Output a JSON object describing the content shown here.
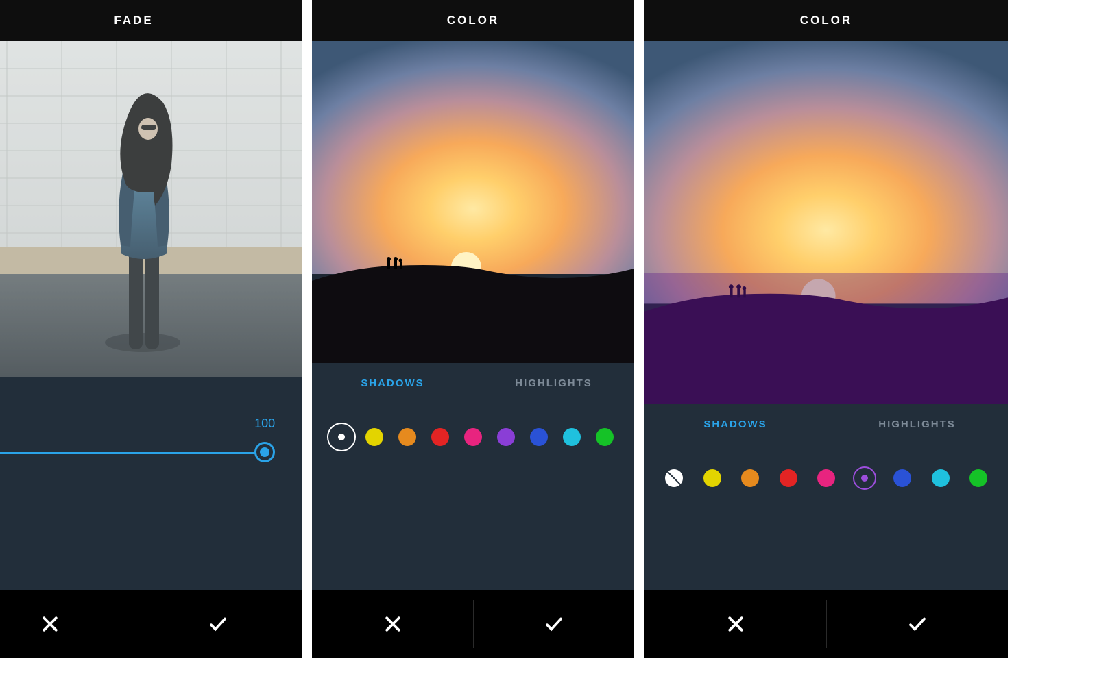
{
  "screens": [
    {
      "id": "fade",
      "title": "FADE",
      "slider": {
        "value_label": "100",
        "value": 100,
        "min": 0,
        "max": 100
      },
      "actions": {
        "cancel_icon": "close-icon",
        "confirm_icon": "check-icon"
      }
    },
    {
      "id": "color-none",
      "title": "COLOR",
      "tabs": {
        "shadows": "SHADOWS",
        "highlights": "HIGHLIGHTS",
        "active": "shadows"
      },
      "swatches": {
        "selected_index": 0,
        "colors": [
          "none",
          "#e3d400",
          "#e68a1e",
          "#e32424",
          "#e8247f",
          "#8a3ed6",
          "#2a52d6",
          "#1fc1de",
          "#15c227"
        ]
      },
      "actions": {
        "cancel_icon": "close-icon",
        "confirm_icon": "check-icon"
      }
    },
    {
      "id": "color-purple",
      "title": "COLOR",
      "tabs": {
        "shadows": "SHADOWS",
        "highlights": "HIGHLIGHTS",
        "active": "shadows"
      },
      "swatches": {
        "selected_index": 5,
        "colors": [
          "none",
          "#e3d400",
          "#e68a1e",
          "#e32424",
          "#e8247f",
          "#8a3ed6",
          "#2a52d6",
          "#1fc1de",
          "#15c227"
        ]
      },
      "actions": {
        "cancel_icon": "close-icon",
        "confirm_icon": "check-icon"
      }
    }
  ],
  "color_hex": {
    "accent_blue": "#2aa3e8",
    "panel_dark": "#222e3a",
    "titlebar_black": "#0e0e0e",
    "action_black": "#000000"
  }
}
